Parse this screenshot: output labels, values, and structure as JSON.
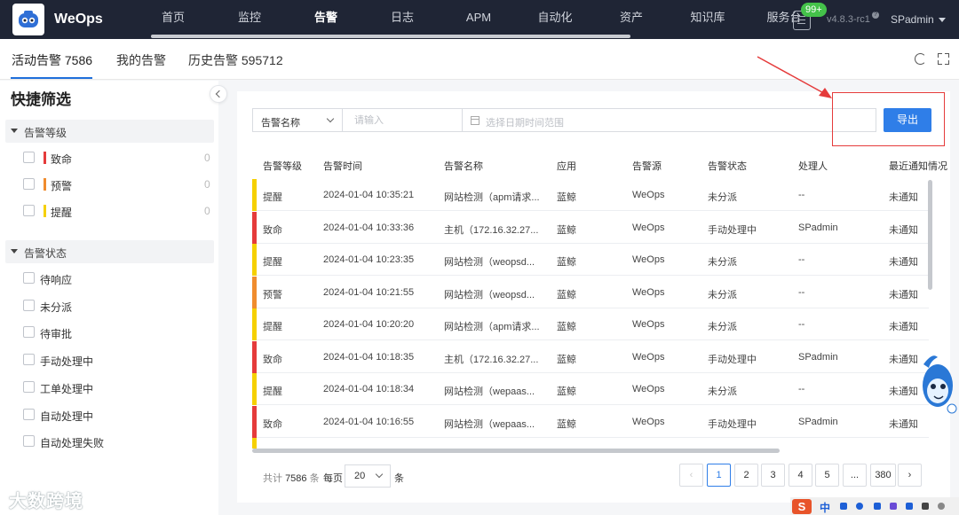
{
  "app": {
    "brand": "WeOps",
    "version": "v4.8.3-rc1",
    "user": "SPadmin",
    "notice_badge": "99+"
  },
  "nav": [
    "首页",
    "监控",
    "告警",
    "日志",
    "APM",
    "自动化",
    "资产",
    "知识库",
    "服务台"
  ],
  "tabs": {
    "active": "活动告警 7586",
    "mine": "我的告警",
    "history": "历史告警 595712"
  },
  "sidebar": {
    "title": "快捷筛选",
    "level_group": "告警等级",
    "levels": [
      {
        "label": "致命",
        "count": "0",
        "color": "#e53b3b"
      },
      {
        "label": "预警",
        "count": "0",
        "color": "#f08c2e"
      },
      {
        "label": "提醒",
        "count": "0",
        "color": "#f5d000"
      }
    ],
    "status_group": "告警状态",
    "statuses": [
      "待响应",
      "未分派",
      "待审批",
      "手动处理中",
      "工单处理中",
      "自动处理中",
      "自动处理失败"
    ]
  },
  "filters": {
    "field_select": "告警名称",
    "keyword_placeholder": "请输入",
    "date_placeholder": "选择日期时间范围",
    "export_label": "导出"
  },
  "table": {
    "headers": [
      "告警等级",
      "告警时间",
      "告警名称",
      "应用",
      "告警源",
      "告警状态",
      "处理人",
      "最近通知情况"
    ],
    "rows": [
      {
        "level": "提醒",
        "color": "#f5d000",
        "time": "2024-01-04 10:35:21",
        "name": "网站检测（apm请求...",
        "app": "蓝鲸",
        "source": "WeOps",
        "status": "未分派",
        "handler": "--",
        "notice": "未通知"
      },
      {
        "level": "致命",
        "color": "#e53b3b",
        "time": "2024-01-04 10:33:36",
        "name": "主机（172.16.32.27...",
        "app": "蓝鲸",
        "source": "WeOps",
        "status": "手动处理中",
        "handler": "SPadmin",
        "notice": "未通知"
      },
      {
        "level": "提醒",
        "color": "#f5d000",
        "time": "2024-01-04 10:23:35",
        "name": "网站检测（weopsd...",
        "app": "蓝鲸",
        "source": "WeOps",
        "status": "未分派",
        "handler": "--",
        "notice": "未通知"
      },
      {
        "level": "预警",
        "color": "#f08c2e",
        "time": "2024-01-04 10:21:55",
        "name": "网站检测（weopsd...",
        "app": "蓝鲸",
        "source": "WeOps",
        "status": "未分派",
        "handler": "--",
        "notice": "未通知"
      },
      {
        "level": "提醒",
        "color": "#f5d000",
        "time": "2024-01-04 10:20:20",
        "name": "网站检测（apm请求...",
        "app": "蓝鲸",
        "source": "WeOps",
        "status": "未分派",
        "handler": "--",
        "notice": "未通知"
      },
      {
        "level": "致命",
        "color": "#e53b3b",
        "time": "2024-01-04 10:18:35",
        "name": "主机（172.16.32.27...",
        "app": "蓝鲸",
        "source": "WeOps",
        "status": "手动处理中",
        "handler": "SPadmin",
        "notice": "未通知"
      },
      {
        "level": "提醒",
        "color": "#f5d000",
        "time": "2024-01-04 10:18:34",
        "name": "网站检测（wepaas...",
        "app": "蓝鲸",
        "source": "WeOps",
        "status": "未分派",
        "handler": "--",
        "notice": "未通知"
      },
      {
        "level": "致命",
        "color": "#e53b3b",
        "time": "2024-01-04 10:16:55",
        "name": "网站检测（wepaas...",
        "app": "蓝鲸",
        "source": "WeOps",
        "status": "手动处理中",
        "handler": "SPadmin",
        "notice": "未通知"
      },
      {
        "level": "",
        "color": "#f5d000",
        "time": "",
        "name": "",
        "app": "",
        "source": "",
        "status": "",
        "handler": "",
        "notice": ""
      }
    ]
  },
  "pagination": {
    "total_prefix": "共计",
    "total": "7586",
    "total_suffix": "条",
    "per_page_label": "每页",
    "per_page": "20",
    "per_page_suffix": "条",
    "pages": [
      "1",
      "2",
      "3",
      "4",
      "5",
      "...",
      "380"
    ],
    "prev": "‹",
    "next": "›"
  },
  "watermark": "大数跨境",
  "ime": {
    "logo": "S",
    "lang": "中"
  }
}
